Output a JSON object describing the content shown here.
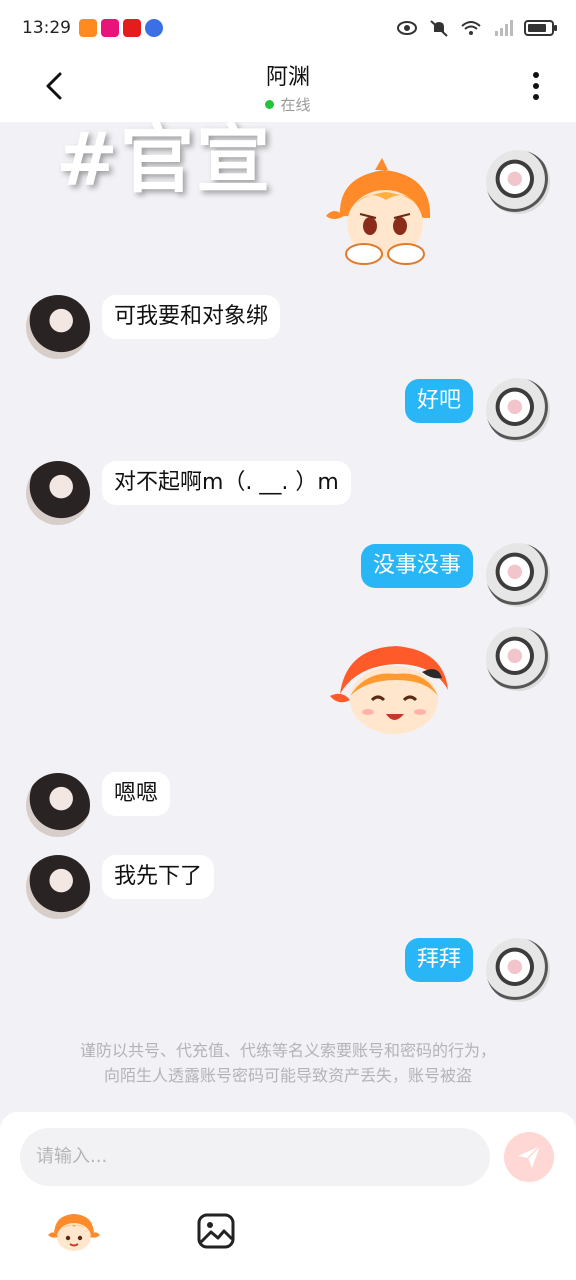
{
  "status_bar": {
    "time": "13:29",
    "icons": [
      "eye-icon",
      "mute-icon",
      "wifi-icon",
      "signal-icon",
      "battery-icon"
    ]
  },
  "header": {
    "contact_name": "阿渊",
    "presence": "在线",
    "presence_color": "#21c43a"
  },
  "watermark": "#官宣",
  "messages": [
    {
      "side": "out",
      "type": "sticker",
      "sticker": "sad-cartoon-sticker"
    },
    {
      "side": "in",
      "type": "text",
      "text": "可我要和对象绑"
    },
    {
      "side": "out",
      "type": "text",
      "text": "好吧"
    },
    {
      "side": "in",
      "type": "text",
      "text": "对不起啊m（. __. ）m"
    },
    {
      "side": "out",
      "type": "text",
      "text": "没事没事"
    },
    {
      "side": "out",
      "type": "sticker",
      "sticker": "happy-cartoon-sticker"
    },
    {
      "side": "in",
      "type": "text",
      "text": "嗯嗯"
    },
    {
      "side": "in",
      "type": "text",
      "text": "我先下了"
    },
    {
      "side": "out",
      "type": "text",
      "text": "拜拜"
    }
  ],
  "notice": {
    "line1": "谨防以共号、代充值、代练等名义索要账号和密码的行为，",
    "line2": "向陌生人透露账号密码可能导致资产丢失，账号被盗"
  },
  "composer": {
    "placeholder": "请输入...",
    "tools": [
      "sticker-icon",
      "image-icon"
    ]
  },
  "colors": {
    "outgoing_bubble": "#29b6f6",
    "incoming_bubble": "#ffffff",
    "background": "#f2f2f6"
  }
}
